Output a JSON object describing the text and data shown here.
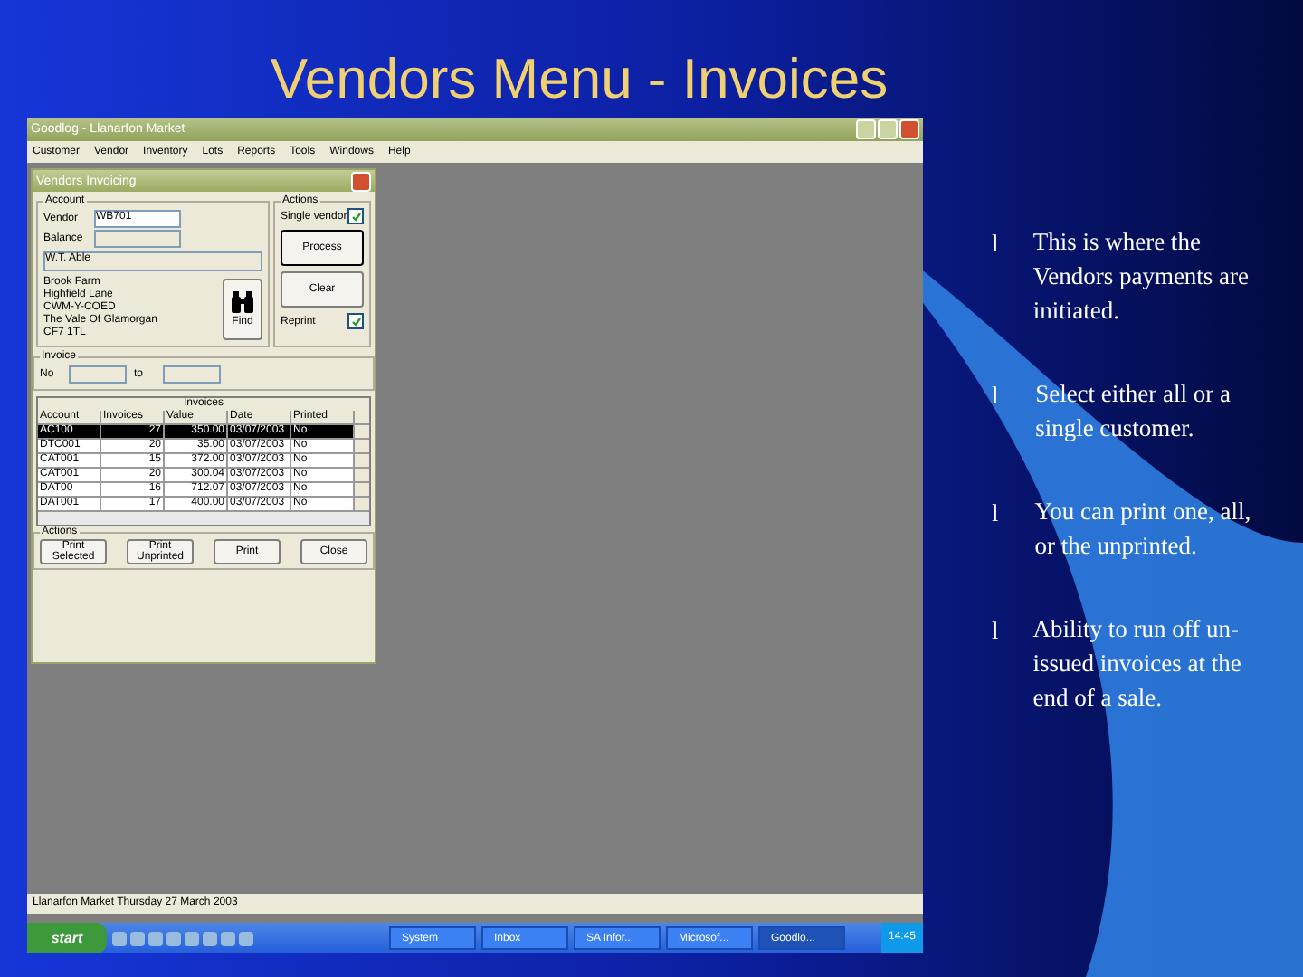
{
  "slide_title": "Vendors Menu - Invoices",
  "app": {
    "title": "Goodlog - Llanarfon Market",
    "menu": [
      "Customer",
      "Vendor",
      "Inventory",
      "Lots",
      "Reports",
      "Tools",
      "Windows",
      "Help"
    ],
    "dialog": {
      "title": "Vendors Invoicing",
      "account": {
        "label": "Account",
        "vendor_label": "Vendor",
        "vendor": "WB701",
        "balance_label": "Balance",
        "name": "W.T. Able",
        "address": [
          "Brook Farm",
          "Highfield Lane",
          "CWM-Y-COED",
          "The Vale Of Glamorgan",
          "CF7 1TL"
        ],
        "find": "Find"
      },
      "actions": {
        "label": "Actions",
        "single_vendor": {
          "label": "Single vendor",
          "checked": true
        },
        "process": "Process",
        "close": "Clear",
        "reprint": {
          "label": "Reprint",
          "checked": true
        }
      },
      "invoice": {
        "label": "Invoice",
        "from_label": "No",
        "to_label": "to"
      },
      "table": {
        "title": "Invoices",
        "columns": [
          "Account",
          "Invoices",
          "Value",
          "Date",
          "Printed"
        ],
        "rows": [
          {
            "cells": [
              "AC100",
              "27",
              "350.00",
              "03/07/2003",
              "No"
            ],
            "selected": true
          },
          {
            "cells": [
              "DTC001",
              "20",
              "35.00",
              "03/07/2003",
              "No"
            ],
            "selected": false
          },
          {
            "cells": [
              "CAT001",
              "15",
              "372.00",
              "03/07/2003",
              "No"
            ],
            "selected": false
          },
          {
            "cells": [
              "CAT001",
              "20",
              "300.04",
              "03/07/2003",
              "No"
            ],
            "selected": false
          },
          {
            "cells": [
              "DAT00",
              "16",
              "712.07",
              "03/07/2003",
              "No"
            ],
            "selected": false
          },
          {
            "cells": [
              "DAT001",
              "17",
              "400.00",
              "03/07/2003",
              "No"
            ],
            "selected": false
          }
        ]
      },
      "bottom": {
        "label": "Actions",
        "buttons": [
          "Print Selected",
          "Print Unprinted",
          "Print",
          "Close"
        ]
      }
    },
    "status": "Llanarfon Market Thursday 27 March 2003",
    "taskbar": {
      "start": "start",
      "tasks": [
        {
          "label": "System",
          "selected": false
        },
        {
          "label": "Inbox",
          "selected": false
        },
        {
          "label": "SA Infor...",
          "selected": false
        },
        {
          "label": "Microsof...",
          "selected": false
        },
        {
          "label": "Goodlo...",
          "selected": true
        }
      ],
      "clock": "14:45"
    }
  },
  "bullets": [
    {
      "marker": "l",
      "text": "This is where the Vendors payments are initiated."
    },
    {
      "marker": "l",
      "text": "Select either all or a single customer."
    },
    {
      "marker": "l",
      "text": "You can print one, all, or the unprinted."
    },
    {
      "marker": "l",
      "text": "Ability to run off un-issued invoices at the end of a sale."
    }
  ]
}
